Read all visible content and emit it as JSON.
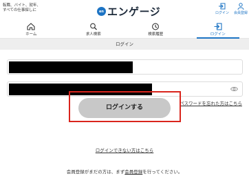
{
  "header": {
    "tagline": "転職、バイト、就年、すべての仕事探しに",
    "logo_badge": "en",
    "logo_text": "エンゲージ",
    "login_label": "ログイン",
    "member_label": "会員登録",
    "accent_color": "#1d74c4"
  },
  "nav": {
    "items": [
      {
        "label": "ホーム",
        "icon": "home-icon"
      },
      {
        "label": "求人検索",
        "icon": "search-icon"
      },
      {
        "label": "検索履歴",
        "icon": "clock-icon"
      },
      {
        "label": "ログイン",
        "icon": "login-icon",
        "active": true
      }
    ]
  },
  "page": {
    "title": "ログイン"
  },
  "form": {
    "email_value": "redacted",
    "password_value": "redacted",
    "forgot_link": "パスワードを忘れた方はこちら",
    "submit_label": "ログインする",
    "cant_login_link": "ログインできない方はこちら"
  },
  "footer": {
    "register_prefix": "会員登録がまだの方は、まず",
    "register_link": "会員登録",
    "register_suffix": "を行ってください。"
  }
}
